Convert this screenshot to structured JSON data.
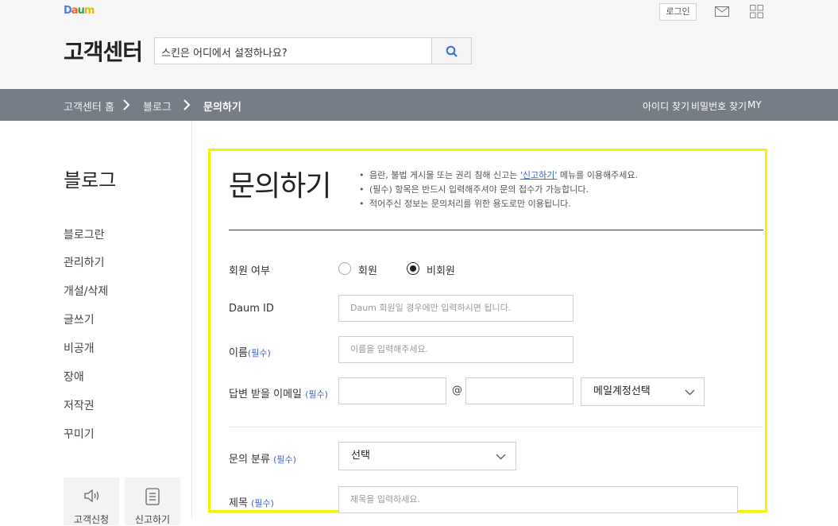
{
  "header": {
    "logo": {
      "d": "D",
      "a": "a",
      "u": "u",
      "m": "m"
    },
    "login": "로그인",
    "title": "고객센터",
    "search_value": "스킨은 어디에서 설정하나요?",
    "mail_icon": "mail-icon",
    "apps_icon": "apps-grid-icon",
    "search_icon": "search-icon"
  },
  "breadcrumb": {
    "items": [
      "고객센터 홈",
      "블로그",
      "문의하기"
    ],
    "links": [
      "아이디 찾기",
      "비밀번호 찾기",
      "MY"
    ]
  },
  "sidebar": {
    "title": "블로그",
    "items": [
      "블로그란",
      "관리하기",
      "개설/삭제",
      "글쓰기",
      "비공개",
      "장애",
      "저작권",
      "꾸미기"
    ],
    "cards": [
      "고객신청",
      "신고하기"
    ]
  },
  "form": {
    "title": "문의하기",
    "notes": {
      "n1_before": "음란, 불법 게시물 또는 권리 침해 신고는 ",
      "n1_link": "'신고하기'",
      "n1_after": " 메뉴를 이용해주세요.",
      "n2": "(필수) 항목은 반드시 입력해주셔야 문의 접수가 가능합니다.",
      "n3": "적어주신 정보는 문의처리를 위한 용도로만 이용됩니다."
    },
    "member_label": "회원 여부",
    "member_option": "회원",
    "nonmember_option": "비회원",
    "selected_option": "비회원",
    "daum_id_label": "Daum ID",
    "daum_id_placeholder": "Daum 회원일 경우에만 입력하시면 됩니다.",
    "name_label": "이름",
    "required": "(필수)",
    "name_placeholder": "이름을 입력해주세요.",
    "email_label": "답변 받을 이메일",
    "at_sign": "@",
    "email_domain_select": "메일계정선택",
    "category_label": "문의 분류",
    "category_select": "선택",
    "subject_label": "제목",
    "subject_placeholder": "제목을 입력하세요."
  },
  "colors": {
    "navbar": "#767d87",
    "accent": "#3a64c8",
    "highlight": "#f7f000"
  }
}
